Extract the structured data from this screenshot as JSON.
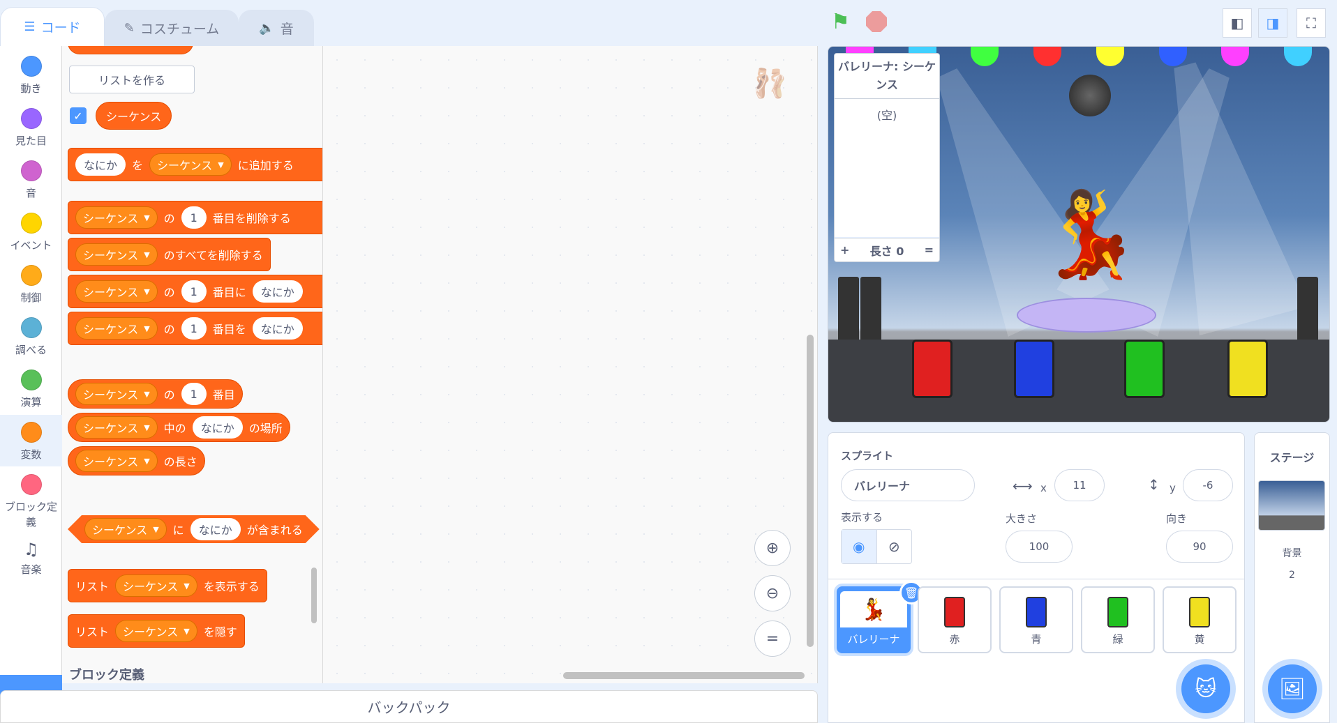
{
  "tabs": [
    {
      "label": "コード",
      "icon": "code-icon"
    },
    {
      "label": "コスチューム",
      "icon": "brush-icon"
    },
    {
      "label": "音",
      "icon": "speaker-icon"
    }
  ],
  "categories": [
    {
      "label": "動き",
      "color": "#4c97ff"
    },
    {
      "label": "見た目",
      "color": "#9966ff"
    },
    {
      "label": "音",
      "color": "#cf63cf"
    },
    {
      "label": "イベント",
      "color": "#ffd500"
    },
    {
      "label": "制御",
      "color": "#ffab19"
    },
    {
      "label": "調べる",
      "color": "#5cb1d6"
    },
    {
      "label": "演算",
      "color": "#59c059"
    },
    {
      "label": "変数",
      "color": "#ff8c1a"
    },
    {
      "label": "ブロック定義",
      "color": "#ff6680"
    },
    {
      "label": "音楽",
      "color": "#575e75"
    }
  ],
  "palette": {
    "make_list": "リストを作る",
    "list_name": "シーケンス",
    "w_thing": "なにか",
    "w_wo": "を",
    "w_add": "に追加する",
    "w_no": "の",
    "num1": "1",
    "w_delete_nth": "番目を削除する",
    "w_delete_all": "のすべてを削除する",
    "w_insert_at": "番目に",
    "w_replace": "番目を",
    "w_nth": "番目",
    "w_in": "中の",
    "w_index": "の場所",
    "w_length": "の長さ",
    "w_ni": "に",
    "w_contains": "が含まれる",
    "w_list": "リスト",
    "w_show": "を表示する",
    "w_hide": "を隠す",
    "section_custom": "ブロック定義"
  },
  "backpack": "バックパック",
  "list_monitor": {
    "title": "バレリーナ: シーケンス",
    "empty": "(空)",
    "plus": "+",
    "length": "長さ 0",
    "equals": "="
  },
  "sprite_info": {
    "sprite_label": "スプライト",
    "sprite_name": "バレリーナ",
    "x_label": "x",
    "x": "11",
    "y_label": "y",
    "y": "-6",
    "show_label": "表示する",
    "size_label": "大きさ",
    "size": "100",
    "direction_label": "向き",
    "direction": "90"
  },
  "sprites": [
    {
      "name": "バレリーナ",
      "color": "#ffffff",
      "selected": true
    },
    {
      "name": "赤",
      "color": "#e02020"
    },
    {
      "name": "青",
      "color": "#2040e0"
    },
    {
      "name": "緑",
      "color": "#20c020"
    },
    {
      "name": "黄",
      "color": "#f0e020"
    }
  ],
  "stage_panel": {
    "title": "ステージ",
    "backdrop_label": "背景",
    "backdrop_count": "2"
  }
}
